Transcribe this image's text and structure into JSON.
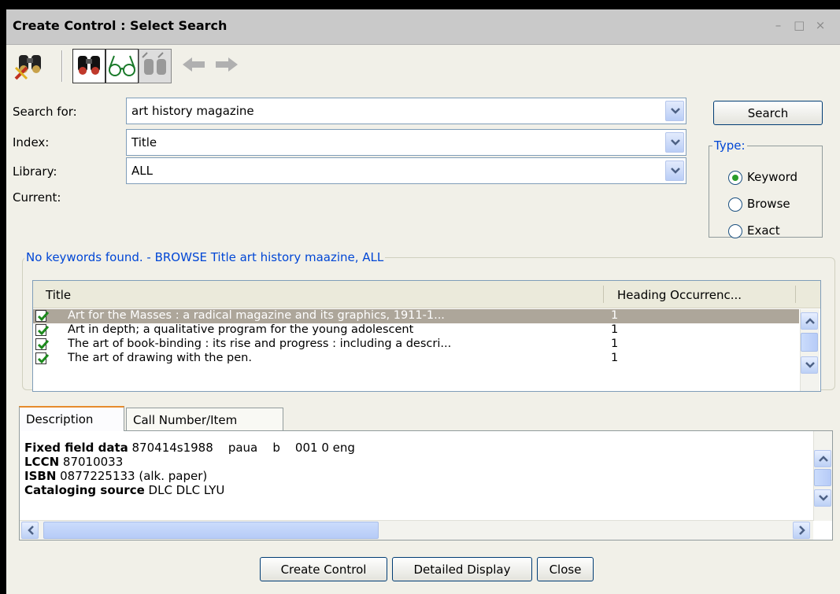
{
  "window": {
    "title": "Create Control : Select Search",
    "controls": [
      "–",
      "□",
      "×"
    ]
  },
  "toolbar": {
    "icons": [
      "binoculars-remove-icon",
      "binoculars-icon",
      "glasses-icon",
      "glasses-disabled-icon",
      "back-arrow-icon",
      "forward-arrow-icon"
    ]
  },
  "form": {
    "search_label": "Search for:",
    "search_value": "art history magazine",
    "index_label": "Index:",
    "index_value": "Title",
    "library_label": "Library:",
    "library_value": "ALL",
    "current_label": "Current:"
  },
  "search_button": "Search",
  "type": {
    "legend": "Type:",
    "options": [
      {
        "label": "Keyword",
        "selected": true
      },
      {
        "label": "Browse",
        "selected": false
      },
      {
        "label": "Exact",
        "selected": false
      }
    ]
  },
  "results": {
    "legend": "No keywords found. - BROWSE Title art history maazine, ALL",
    "columns": [
      "Title",
      "Heading Occurrenc..."
    ],
    "rows": [
      {
        "title": "Art for the Masses : a radical magazine and its graphics, 1911-1...",
        "count": "1",
        "selected": true
      },
      {
        "title": "Art in depth; a qualitative program for the young adolescent",
        "count": "1",
        "selected": false
      },
      {
        "title": "The art of book-binding : its rise and progress : including a descri...",
        "count": "1",
        "selected": false
      },
      {
        "title": "The art of drawing with the pen.",
        "count": "1",
        "selected": false
      }
    ]
  },
  "tabs": [
    "Description",
    "Call Number/Item"
  ],
  "description": {
    "lines": [
      {
        "label": "Fixed field data",
        "value": " 870414s1988    paua    b    001 0 eng"
      },
      {
        "label": "LCCN",
        "value": " 87010033"
      },
      {
        "label": "ISBN",
        "value": " 0877225133 (alk. paper)"
      },
      {
        "label": "Cataloging source",
        "value": " DLC DLC LYU"
      }
    ]
  },
  "buttons": {
    "create_control": "Create Control",
    "detailed_display": "Detailed Display",
    "close": "Close"
  },
  "colors": {
    "legend_blue": "#0046d5",
    "selected_row": "#ada69a",
    "tab_accent": "#e68b2c"
  }
}
